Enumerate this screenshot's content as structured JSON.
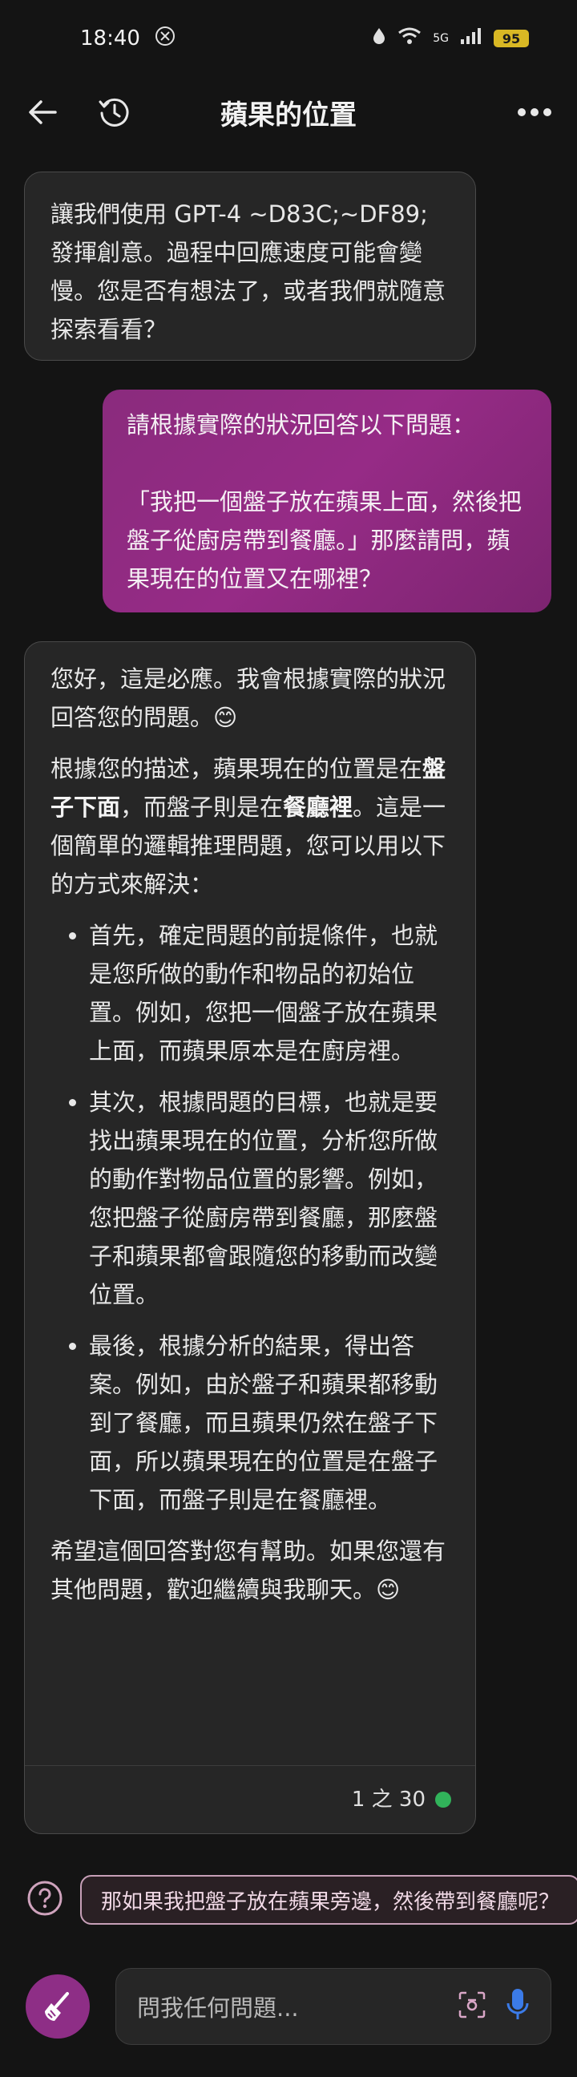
{
  "status_bar": {
    "time": "18:40",
    "battery": "95",
    "network": "5G"
  },
  "header": {
    "title": "蘋果的位置"
  },
  "messages": {
    "greeting": "讓我們使用 GPT-4 ~D83C;~DF89; 發揮創意。過程中回應速度可能會變慢。您是否有想法了，或者我們就隨意探索看看？",
    "user_line1": "請根據實際的狀況回答以下問題：",
    "user_line2": "「我把一個盤子放在蘋果上面，然後把盤子從廚房帶到餐廳。」那麼請問，蘋果現在的位置又在哪裡？",
    "reply": {
      "p1": "您好，這是必應。我會根據實際的狀況回答您的問題。😊",
      "p2_a": "根據您的描述，蘋果現在的位置是在",
      "p2_b": "盤子下面",
      "p2_c": "，而盤子則是在",
      "p2_d": "餐廳裡",
      "p2_e": "。這是一個簡單的邏輯推理問題，您可以用以下的方式來解決：",
      "bullets": [
        "首先，確定問題的前提條件，也就是您所做的動作和物品的初始位置。例如，您把一個盤子放在蘋果上面，而蘋果原本是在廚房裡。",
        "其次，根據問題的目標，也就是要找出蘋果現在的位置，分析您所做的動作對物品位置的影響。例如，您把盤子從廚房帶到餐廳，那麼盤子和蘋果都會跟隨您的移動而改變位置。",
        "最後，根據分析的結果，得出答案。例如，由於盤子和蘋果都移動到了餐廳，而且蘋果仍然在盤子下面，所以蘋果現在的位置是在盤子下面，而盤子則是在餐廳裡。"
      ],
      "p3": "希望這個回答對您有幫助。如果您還有其他問題，歡迎繼續與我聊天。😊",
      "counter": "1 之 30"
    }
  },
  "suggestion": {
    "text": "那如果我把盤子放在蘋果旁邊，然後帶到餐廳呢？"
  },
  "input": {
    "placeholder": "問我任何問題..."
  },
  "colors": {
    "accent": "#8e2e86",
    "user_bubble": "#962b86",
    "status_dot": "#31b35a"
  }
}
